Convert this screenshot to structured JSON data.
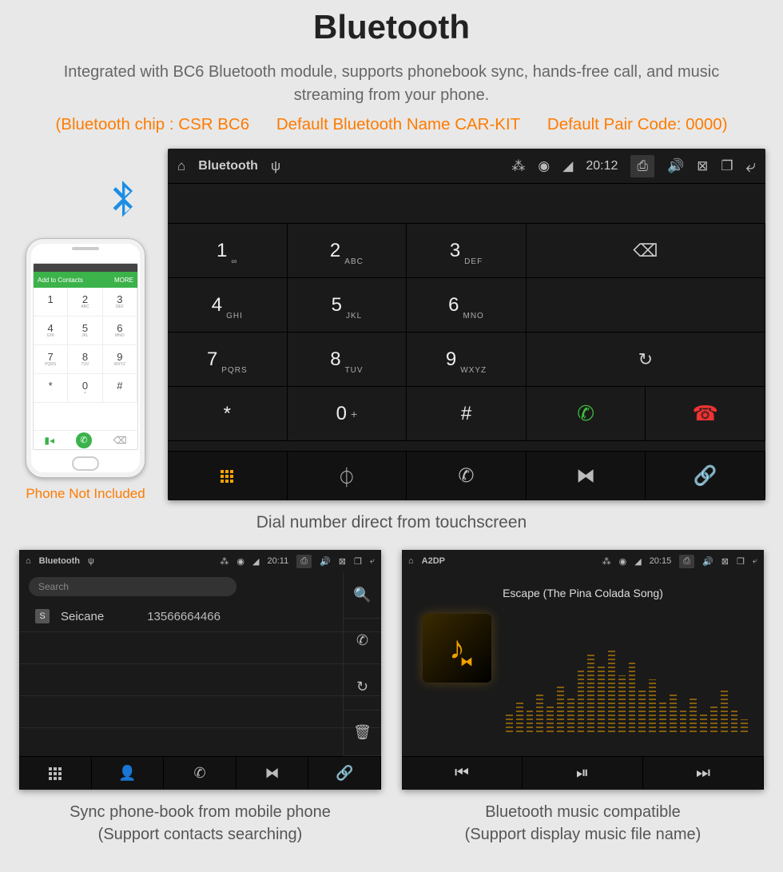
{
  "title": "Bluetooth",
  "subtitle": "Integrated with BC6 Bluetooth module, supports phonebook sync, hands-free call, and music streaming from your phone.",
  "specs": {
    "chip": "(Bluetooth chip : CSR BC6",
    "name": "Default Bluetooth Name CAR-KIT",
    "pair": "Default Pair Code: 0000)"
  },
  "phone": {
    "green_bar": "Add to Contacts",
    "green_more": "MORE",
    "caption": "Phone Not Included",
    "keys": [
      {
        "n": "1",
        "s": ""
      },
      {
        "n": "2",
        "s": "ABC"
      },
      {
        "n": "3",
        "s": "DEF"
      },
      {
        "n": "4",
        "s": "GHI"
      },
      {
        "n": "5",
        "s": "JKL"
      },
      {
        "n": "6",
        "s": "MNO"
      },
      {
        "n": "7",
        "s": "PQRS"
      },
      {
        "n": "8",
        "s": "TUV"
      },
      {
        "n": "9",
        "s": "WXYZ"
      },
      {
        "n": "*",
        "s": ""
      },
      {
        "n": "0",
        "s": "+"
      },
      {
        "n": "#",
        "s": ""
      }
    ]
  },
  "headunit": {
    "status_title": "Bluetooth",
    "time": "20:12",
    "keys": [
      {
        "n": "1",
        "s": "∞"
      },
      {
        "n": "2",
        "s": "ABC"
      },
      {
        "n": "3",
        "s": "DEF"
      },
      {
        "n": "4",
        "s": "GHI"
      },
      {
        "n": "5",
        "s": "JKL"
      },
      {
        "n": "6",
        "s": "MNO"
      },
      {
        "n": "7",
        "s": "PQRS"
      },
      {
        "n": "8",
        "s": "TUV"
      },
      {
        "n": "9",
        "s": "WXYZ"
      },
      {
        "n": "*",
        "s": ""
      },
      {
        "n": "0",
        "s": "+"
      },
      {
        "n": "#",
        "s": ""
      }
    ],
    "caption": "Dial number direct from touchscreen"
  },
  "phonebook": {
    "status_title": "Bluetooth",
    "time": "20:11",
    "search": "Search",
    "contact_badge": "S",
    "contact_name": "Seicane",
    "contact_number": "13566664466",
    "caption_l1": "Sync phone-book from mobile phone",
    "caption_l2": "(Support contacts searching)"
  },
  "music": {
    "status_title": "A2DP",
    "time": "20:15",
    "song": "Escape (The Pina Colada Song)",
    "caption_l1": "Bluetooth music compatible",
    "caption_l2": "(Support display music file name)"
  }
}
